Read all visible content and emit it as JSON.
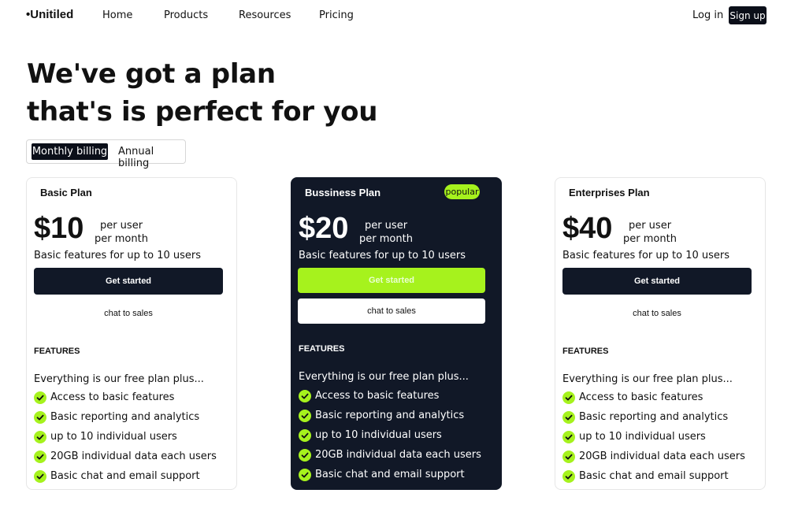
{
  "header": {
    "brand": "•Unitiled",
    "nav": [
      "Home",
      "Products",
      "Resources",
      "Pricing"
    ],
    "login": "Log in",
    "signup": "Sign up"
  },
  "hero": {
    "line1": "We've got a plan",
    "line2": "that's is perfect for you"
  },
  "billing": {
    "monthly": "Monthly billing",
    "annual": "Annual billing",
    "selected": "Monthly billing"
  },
  "colors": {
    "accent": "#a6f21d",
    "dark": "#111827"
  },
  "plans": [
    {
      "name": "Basic Plan",
      "badge": "",
      "price": "$10",
      "per_user": "per user",
      "per_month": "per month",
      "description": "Basic features for up to 10 users",
      "primary_cta": "Get started",
      "secondary_cta": "chat to sales",
      "features_title": "FEATURES",
      "features_intro": "Everything is our free plan plus...",
      "features": [
        "Access to basic features",
        "Basic reporting and analytics",
        "up to 10 individual users",
        "20GB individual data each users",
        "Basic chat and email support"
      ]
    },
    {
      "name": "Bussiness Plan",
      "badge": "popular",
      "price": "$20",
      "per_user": "per user",
      "per_month": "per month",
      "description": "Basic features for up to 10 users",
      "primary_cta": "Get started",
      "secondary_cta": "chat to sales",
      "features_title": "FEATURES",
      "features_intro": "Everything is our free plan plus...",
      "features": [
        "Access to basic features",
        "Basic reporting and analytics",
        "up to 10 individual users",
        "20GB individual data each users",
        "Basic chat and email support"
      ]
    },
    {
      "name": "Enterprises Plan",
      "badge": "",
      "price": "$40",
      "per_user": "per user",
      "per_month": "per month",
      "description": "Basic features for up to 10 users",
      "primary_cta": "Get started",
      "secondary_cta": "chat to sales",
      "features_title": "FEATURES",
      "features_intro": "Everything is our free plan plus...",
      "features": [
        "Access to basic features",
        "Basic reporting and analytics",
        "up to 10 individual users",
        "20GB individual data each users",
        "Basic chat and email support"
      ]
    }
  ]
}
